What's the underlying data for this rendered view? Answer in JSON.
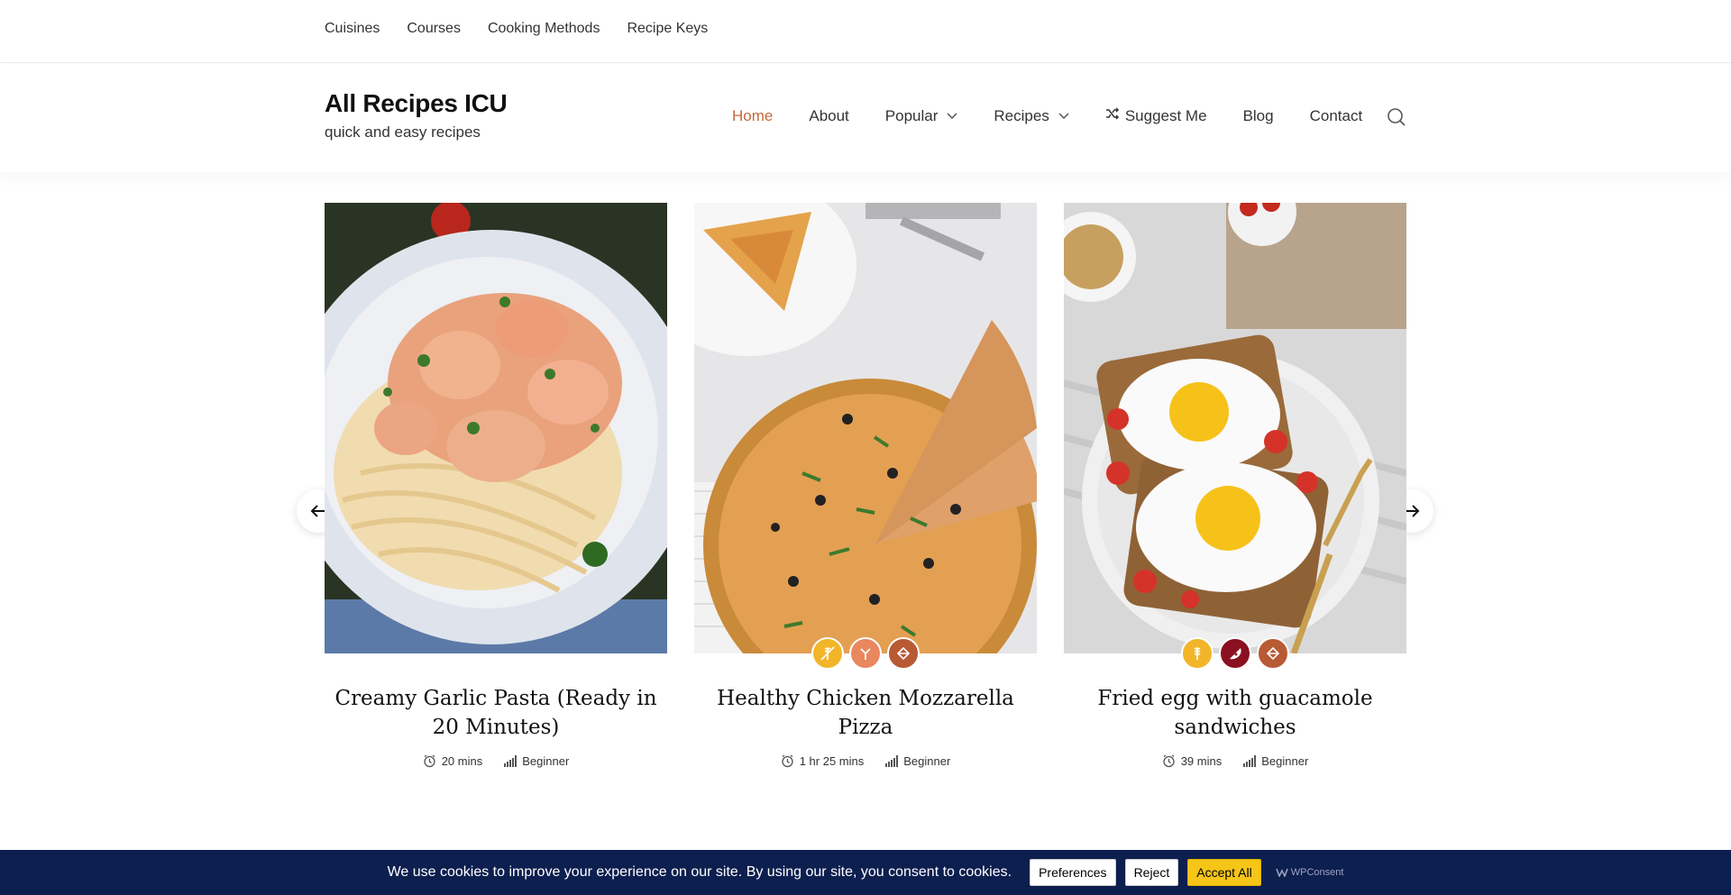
{
  "topnav": [
    "Cuisines",
    "Courses",
    "Cooking Methods",
    "Recipe Keys"
  ],
  "site": {
    "title": "All Recipes ICU",
    "tagline": "quick and easy recipes"
  },
  "mainnav": {
    "home": "Home",
    "about": "About",
    "popular": "Popular",
    "recipes": "Recipes",
    "suggest": "Suggest Me",
    "blog": "Blog",
    "contact": "Contact"
  },
  "icons": {
    "search": "search-icon",
    "shuffle": "shuffle-icon",
    "prev": "arrow-left-icon",
    "next": "arrow-right-icon",
    "time": "alarm-clock-icon",
    "difficulty": "signal-bars-icon"
  },
  "recipes": [
    {
      "title": "Creamy Garlic Pasta (Ready in 20 Minutes)",
      "time": "20 mins",
      "difficulty": "Beginner",
      "image": "shrimp-pasta-photo"
    },
    {
      "title": "Healthy Chicken Mozzarella Pizza",
      "time": "1 hr 25 mins",
      "difficulty": "Beginner",
      "image": "pizza-photo",
      "badges": [
        {
          "icon": "no-grain-icon",
          "color": "#f2b52a"
        },
        {
          "icon": "dairy-free-icon",
          "color": "#e9875f"
        },
        {
          "icon": "vegan-icon",
          "color": "#b85a34"
        }
      ]
    },
    {
      "title": "Fried egg with guacamole sandwiches",
      "time": "39 mins",
      "difficulty": "Beginner",
      "image": "fried-egg-toast-photo",
      "badges": [
        {
          "icon": "wheat-icon",
          "color": "#f2b52a"
        },
        {
          "icon": "pizza-slice-icon",
          "color": "#8b1020"
        },
        {
          "icon": "vegan-icon",
          "color": "#b85a34"
        }
      ]
    }
  ],
  "cookie": {
    "message": "We use cookies to improve your experience on our site. By using our site, you consent to cookies.",
    "preferences": "Preferences",
    "reject": "Reject",
    "accept": "Accept All",
    "brand": "WPConsent"
  },
  "colors": {
    "accent": "#c36a3c",
    "cookie_bg": "#0d1f4f",
    "accept_btn": "#f5c518"
  }
}
